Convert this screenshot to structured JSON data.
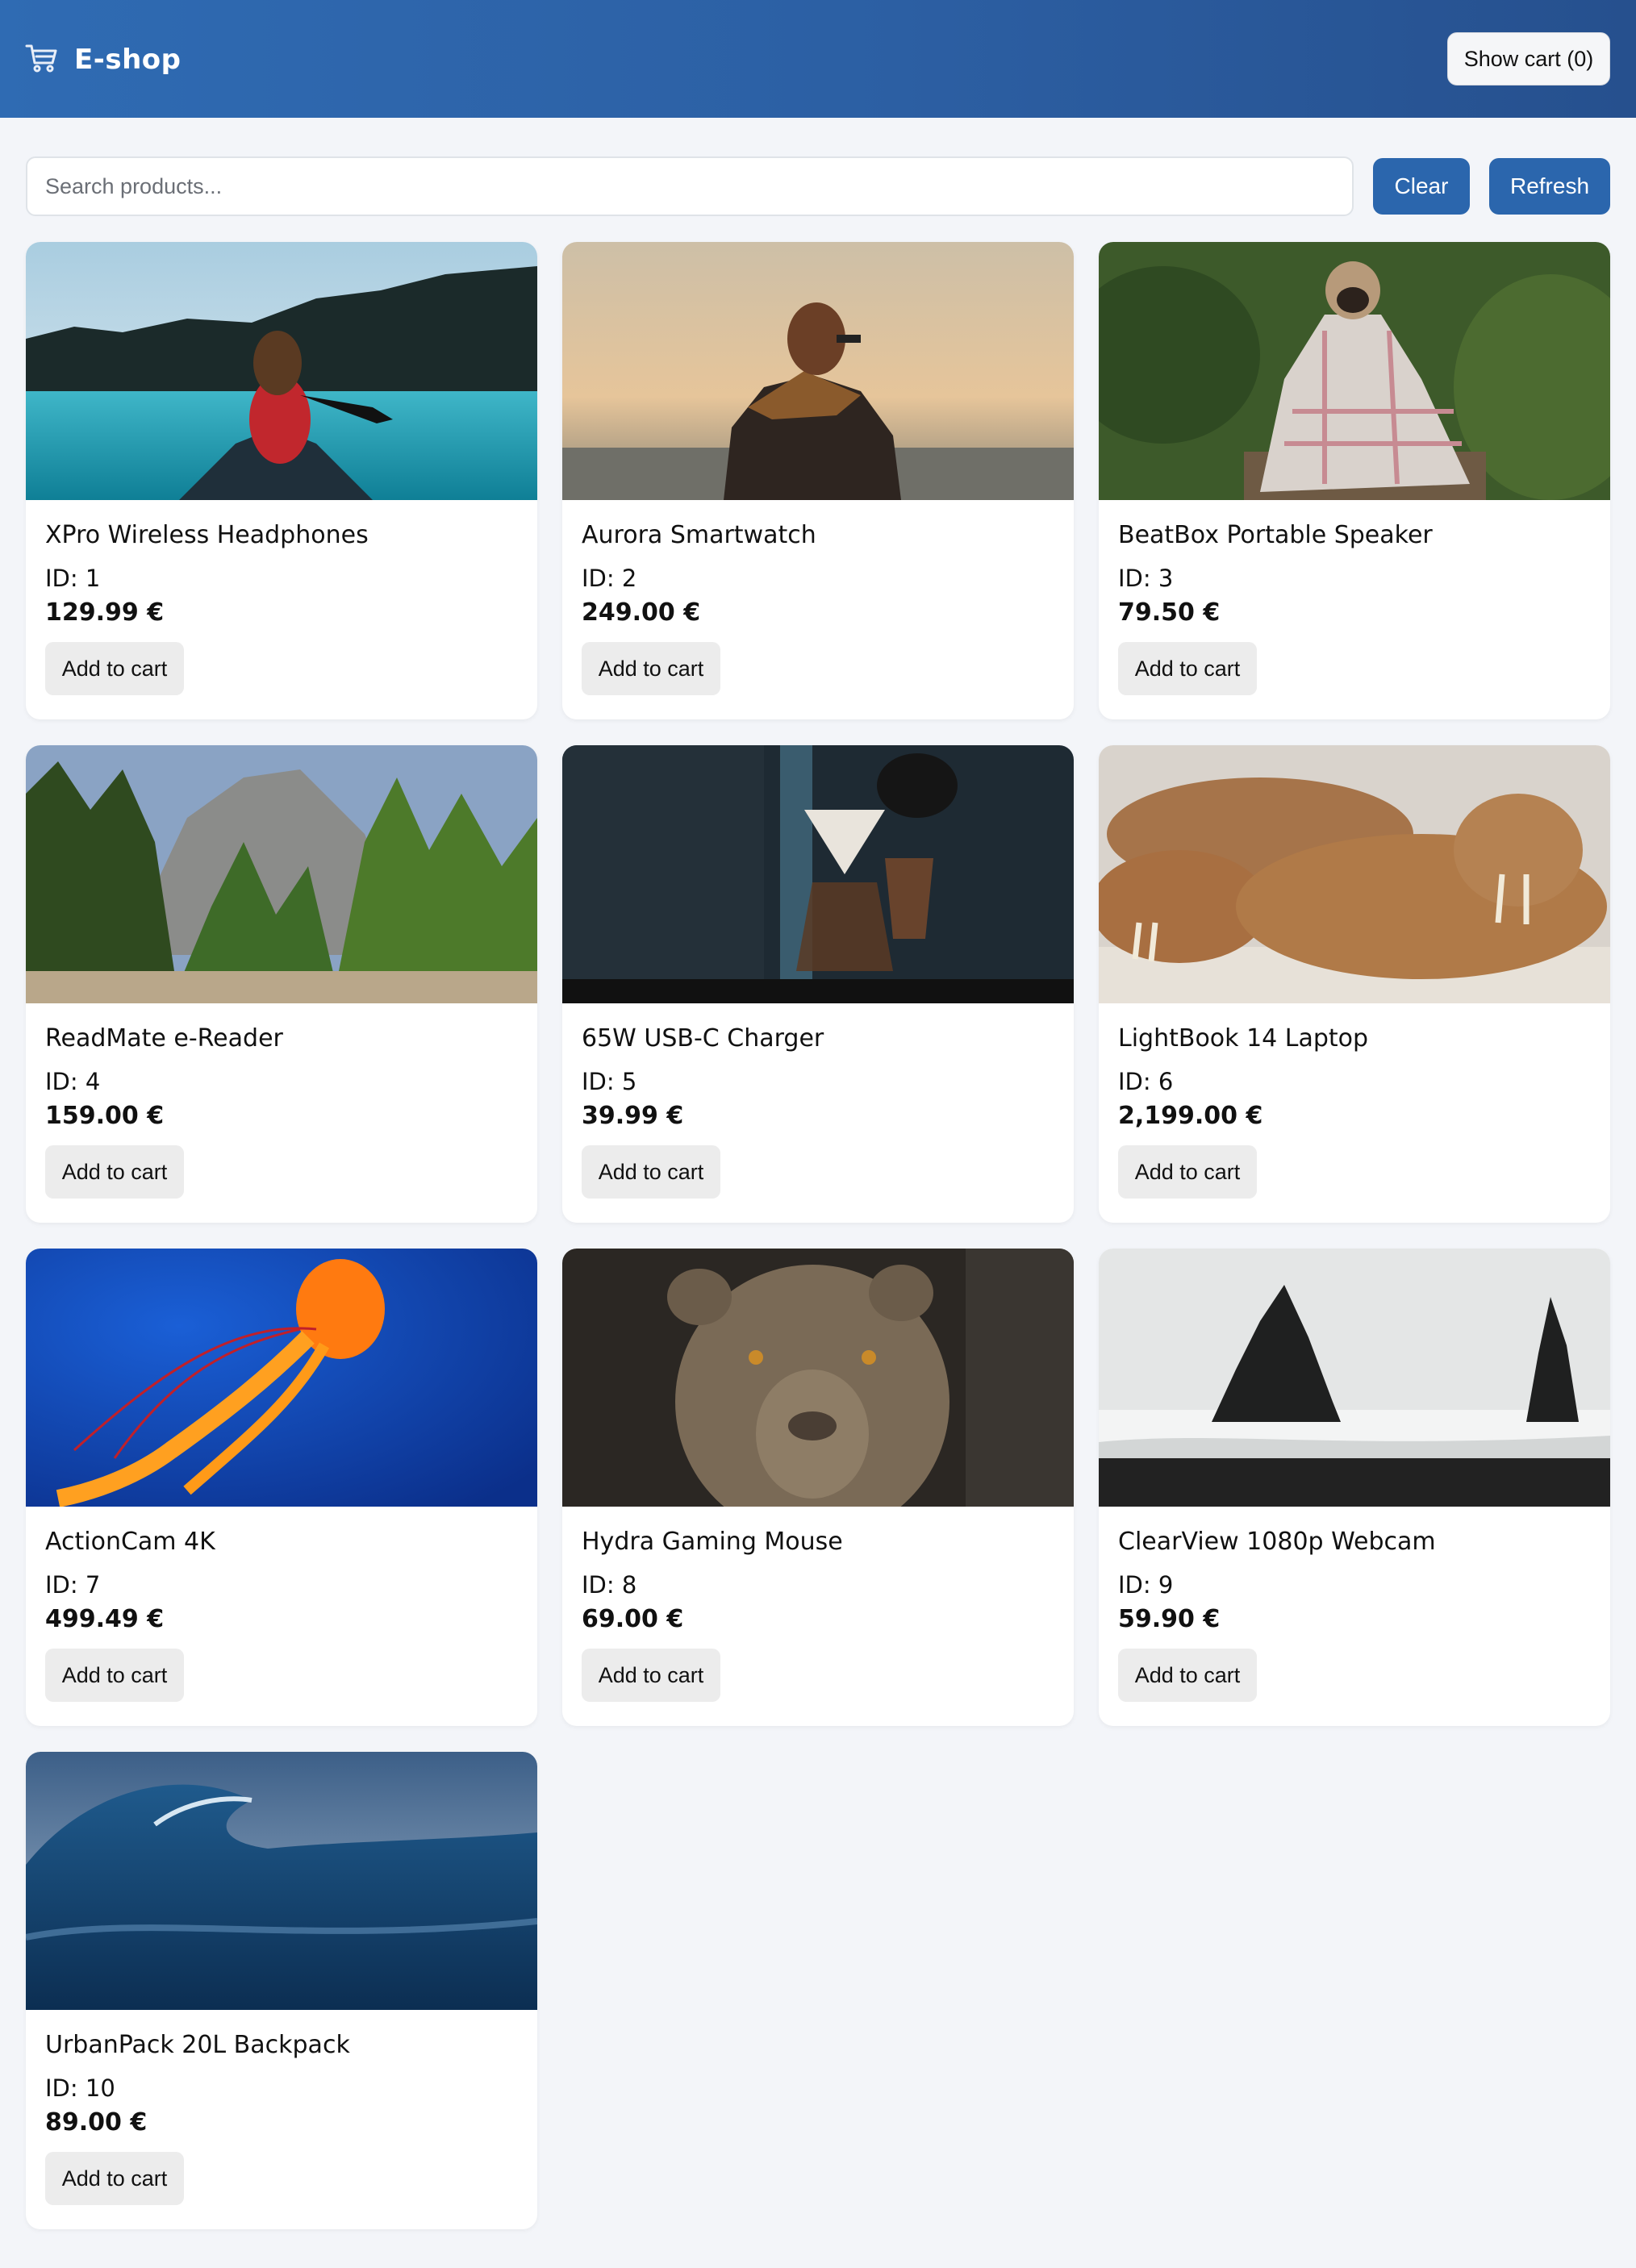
{
  "header": {
    "brand_name": "E-shop",
    "brand_icon": "shopping-cart-icon",
    "show_cart_label": "Show cart (0)"
  },
  "search": {
    "placeholder": "Search products...",
    "value": "",
    "clear_label": "Clear",
    "refresh_label": "Refresh"
  },
  "colors": {
    "header_gradient": [
      "#2f6bb3",
      "#26508e"
    ],
    "primary_button": "#2b66ad",
    "page_background": "#f3f5f9"
  },
  "products": [
    {
      "name": "XPro Wireless Headphones",
      "id_label": "ID: 1",
      "price": "129.99 €",
      "button": "Add to cart",
      "image": "woman-in-canoe-on-lake"
    },
    {
      "name": "Aurora Smartwatch",
      "id_label": "ID: 2",
      "price": "249.00 €",
      "button": "Add to cart",
      "image": "person-with-scarf-at-sunset-sea"
    },
    {
      "name": "BeatBox Portable Speaker",
      "id_label": "ID: 3",
      "price": "79.50 €",
      "button": "Add to cart",
      "image": "pug-wrapped-in-blanket"
    },
    {
      "name": "ReadMate e-Reader",
      "id_label": "ID: 4",
      "price": "159.00 €",
      "button": "Add to cart",
      "image": "forest-and-granite-cliffs"
    },
    {
      "name": "65W USB-C Charger",
      "id_label": "ID: 5",
      "price": "39.99 €",
      "button": "Add to cart",
      "image": "pour-over-coffee-setup"
    },
    {
      "name": "LightBook 14 Laptop",
      "id_label": "ID: 6",
      "price": "2,199.00 €",
      "button": "Add to cart",
      "image": "walruses-on-beach"
    },
    {
      "name": "ActionCam 4K",
      "id_label": "ID: 7",
      "price": "499.49 €",
      "button": "Add to cart",
      "image": "orange-jellyfish-in-blue-water"
    },
    {
      "name": "Hydra Gaming Mouse",
      "id_label": "ID: 8",
      "price": "69.00 €",
      "button": "Add to cart",
      "image": "lioness-portrait"
    },
    {
      "name": "ClearView 1080p Webcam",
      "id_label": "ID: 9",
      "price": "59.90 €",
      "button": "Add to cart",
      "image": "sea-stacks-black-beach"
    },
    {
      "name": "UrbanPack 20L Backpack",
      "id_label": "ID: 10",
      "price": "89.00 €",
      "button": "Add to cart",
      "image": "ocean-wave"
    }
  ]
}
